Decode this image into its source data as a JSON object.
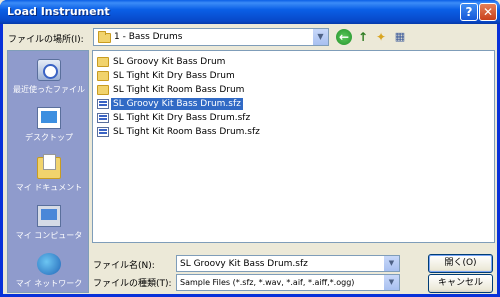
{
  "window": {
    "title": "Load Instrument"
  },
  "titlebar_buttons": {
    "help": "?",
    "close": "✕"
  },
  "lookin": {
    "label": "ファイルの場所(I):",
    "value": "1 - Bass Drums"
  },
  "places": [
    {
      "label": "最近使ったファイル",
      "icon": "recent-files-icon"
    },
    {
      "label": "デスクトップ",
      "icon": "desktop-icon"
    },
    {
      "label": "マイ ドキュメント",
      "icon": "my-documents-icon"
    },
    {
      "label": "マイ コンピュータ",
      "icon": "my-computer-icon"
    },
    {
      "label": "マイ ネットワーク",
      "icon": "my-network-icon"
    }
  ],
  "files": [
    {
      "name": "SL Groovy Kit Bass Drum",
      "type": "folder"
    },
    {
      "name": "SL Tight Kit Dry Bass Drum",
      "type": "folder"
    },
    {
      "name": "SL Tight Kit Room Bass Drum",
      "type": "folder"
    },
    {
      "name": "SL Groovy Kit Bass Drum.sfz",
      "type": "sfz",
      "selected": true
    },
    {
      "name": "SL Tight Kit Dry Bass Drum.sfz",
      "type": "sfz"
    },
    {
      "name": "SL Tight Kit Room Bass Drum.sfz",
      "type": "sfz"
    }
  ],
  "filename": {
    "label": "ファイル名(N):",
    "value": "SL Groovy Kit Bass Drum.sfz"
  },
  "filetype": {
    "label": "ファイルの種類(T):",
    "value": "Sample Files (*.sfz, *.wav, *.aif, *.aiff,*.ogg)"
  },
  "buttons": {
    "open": "開く(O)",
    "cancel": "キャンセル"
  },
  "glyphs": {
    "dropdown": "▼",
    "back": "←",
    "up": "↑",
    "new_folder": "✦",
    "views": "▦"
  }
}
